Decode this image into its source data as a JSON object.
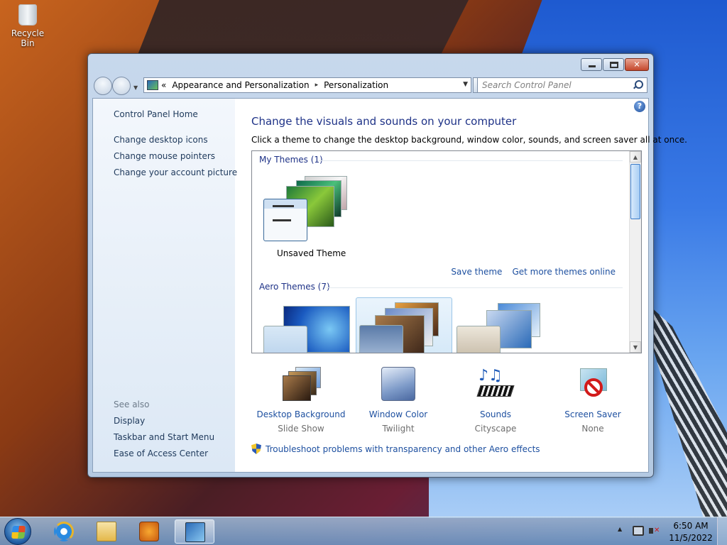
{
  "desktop": {
    "icons": [
      {
        "label": "Recycle Bin",
        "icon": "recycle-bin-icon"
      }
    ]
  },
  "window": {
    "address": {
      "chevrons": "«",
      "crumbs": [
        "Appearance and Personalization",
        "Personalization"
      ],
      "separator": "▸"
    },
    "search": {
      "placeholder": "Search Control Panel"
    },
    "sidebar": {
      "home": "Control Panel Home",
      "links": [
        "Change desktop icons",
        "Change mouse pointers",
        "Change your account picture"
      ],
      "see_also_title": "See also",
      "see_also": [
        "Display",
        "Taskbar and Start Menu",
        "Ease of Access Center"
      ]
    },
    "main": {
      "title": "Change the visuals and sounds on your computer",
      "subtitle": "Click a theme to change the desktop background, window color, sounds, and screen saver all at once.",
      "my_themes": {
        "title": "My Themes (1)",
        "items": [
          {
            "label": "Unsaved Theme"
          }
        ]
      },
      "links": {
        "save": "Save theme",
        "more": "Get more themes online"
      },
      "aero_themes": {
        "title": "Aero Themes (7)"
      },
      "settings": [
        {
          "label": "Desktop Background",
          "value": "Slide Show",
          "icon": "desktop-background-icon"
        },
        {
          "label": "Window Color",
          "value": "Twilight",
          "icon": "window-color-icon"
        },
        {
          "label": "Sounds",
          "value": "Cityscape",
          "icon": "sounds-icon"
        },
        {
          "label": "Screen Saver",
          "value": "None",
          "icon": "screen-saver-icon"
        }
      ],
      "troubleshoot": "Troubleshoot problems with transparency and other Aero effects"
    }
  },
  "taskbar": {
    "clock": {
      "time": "6:50 AM",
      "date": "11/5/2022"
    }
  }
}
